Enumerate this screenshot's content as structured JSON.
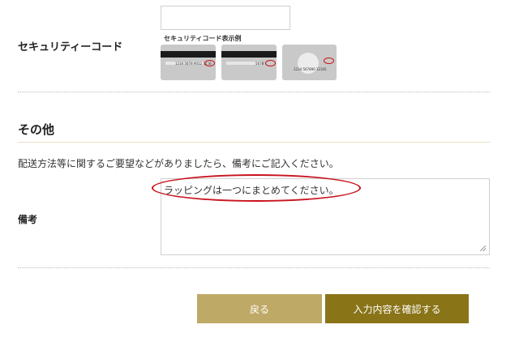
{
  "security_code": {
    "label": "セキュリティーコード",
    "input_value": "",
    "example_label": "セキュリティコード表示例",
    "cards": [
      {
        "type": "back-stripe",
        "number_text": "1234 5678 9012 3456",
        "code": "123"
      },
      {
        "type": "back-stripe-2",
        "number_text": "5678",
        "code": "123"
      },
      {
        "type": "front-amex",
        "number_text": "1234 567890 12345",
        "code": "1234"
      }
    ]
  },
  "other": {
    "heading": "その他",
    "instruction": "配送方法等に関するご要望などがありましたら、備考にご記入ください。",
    "remarks_label": "備考",
    "remarks_value": "ラッピングは一つにまとめてください。"
  },
  "buttons": {
    "back": "戻る",
    "confirm": "入力内容を確認する"
  },
  "colors": {
    "back_button": "#bfa966",
    "confirm_button": "#8a7418",
    "annotation": "#c8141d"
  }
}
